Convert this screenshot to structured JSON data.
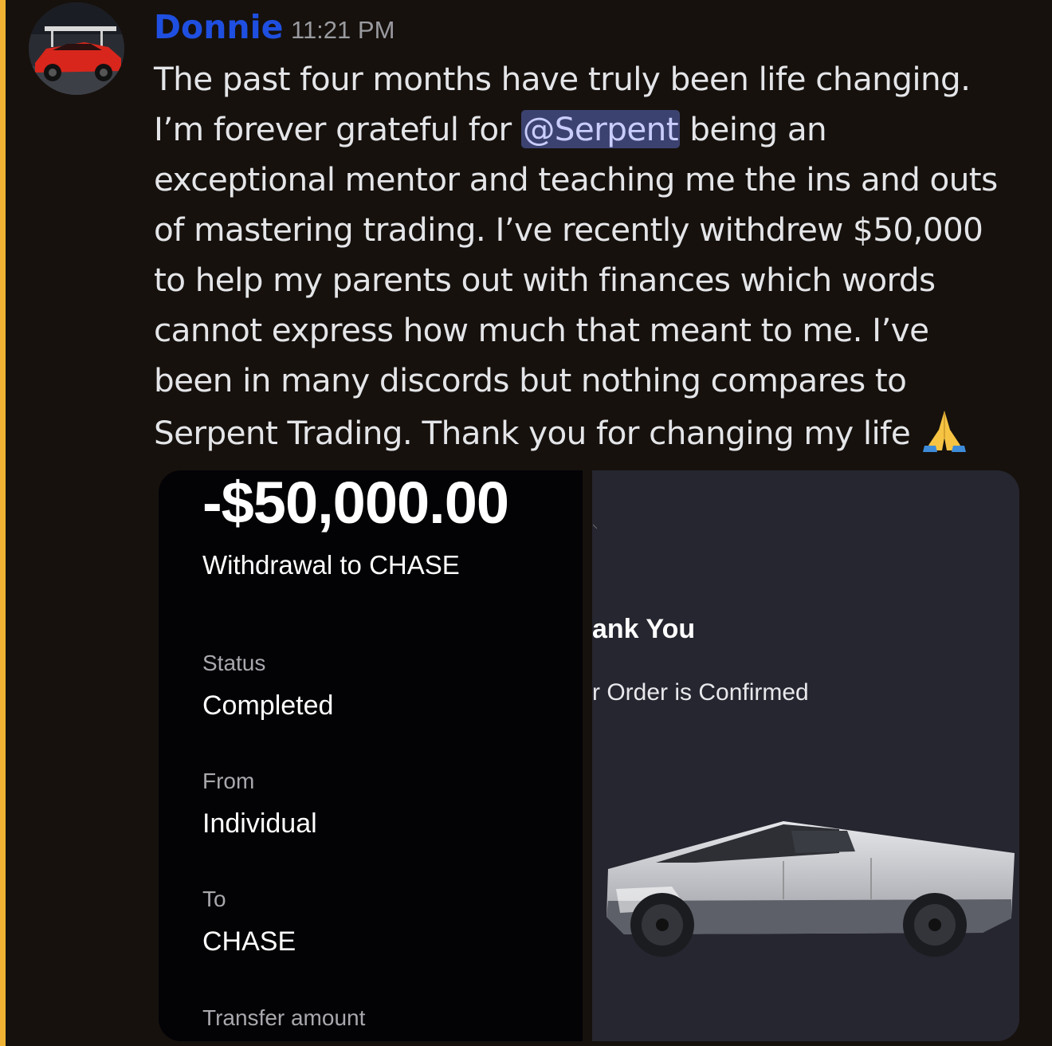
{
  "message": {
    "author": "Donnie",
    "timestamp": "11:21 PM",
    "text_before_mention": "The past four months have truly been life changing.\nI’m forever grateful for ",
    "mention": "@Serpent",
    "text_after_mention": " being an\nexceptional mentor and teaching me the ins and outs\nof mastering trading. I’ve recently withdrew $50,000\nto help my parents out with finances which words\ncannot express how much that meant to me. I’ve\nbeen in many discords but nothing compares to\nSerpent Trading. Thank you for changing my life ",
    "emoji": "folded-hands-icon",
    "author_color": "#1f4fe0",
    "mention_bg": "#3c4270"
  },
  "withdrawal": {
    "amount": "-$50,000.00",
    "title": "Withdrawal to CHASE",
    "status_label": "Status",
    "status_value": "Completed",
    "from_label": "From",
    "from_value": "Individual",
    "to_label": "To",
    "to_value": "CHASE",
    "transfer_amount_label": "Transfer amount"
  },
  "order": {
    "mark": "⸜",
    "thank_you": "ank You",
    "confirmed": "r Order is Confirmed"
  }
}
